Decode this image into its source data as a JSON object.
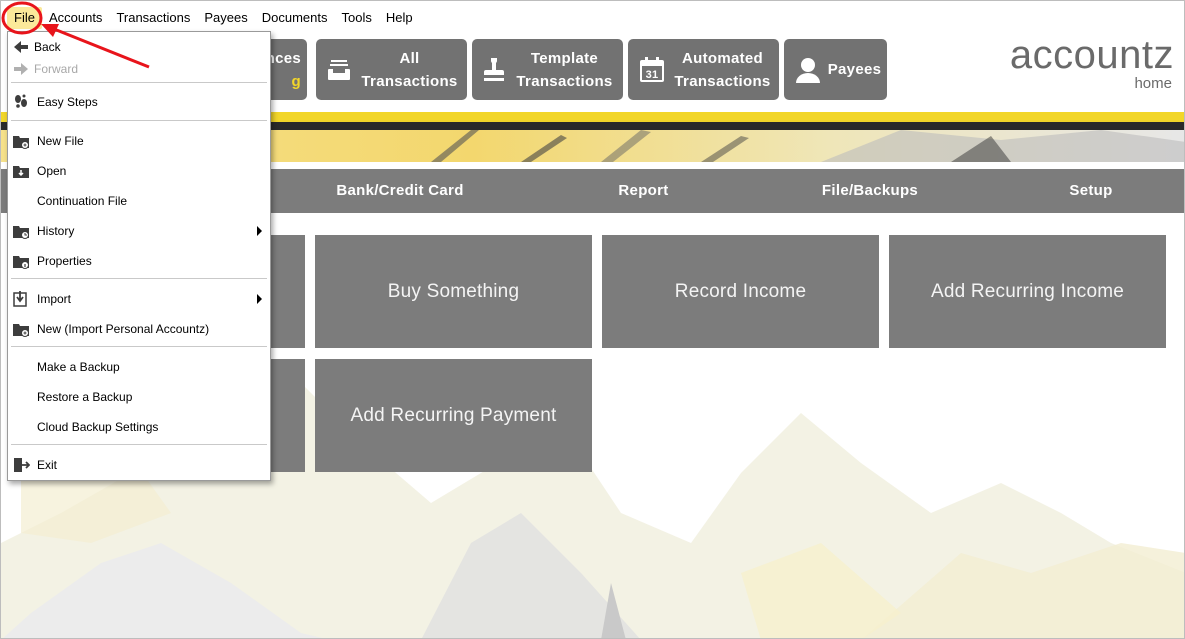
{
  "menubar": [
    "File",
    "Accounts",
    "Transactions",
    "Payees",
    "Documents",
    "Tools",
    "Help"
  ],
  "nav_buttons": {
    "partial_line1": "nces",
    "partial_line2": "g",
    "all": [
      "All",
      "Transactions"
    ],
    "template": [
      "Template",
      "Transactions"
    ],
    "automated": [
      "Automated",
      "Transactions"
    ],
    "payees": "Payees",
    "calendar_day": "31"
  },
  "logo": {
    "word": "accountz",
    "sub": "home"
  },
  "tabs": [
    "Bank/Credit Card",
    "Report",
    "File/Backups",
    "Setup"
  ],
  "tiles": [
    "Buy Something",
    "Record Income",
    "Add Recurring Income",
    "Add Recurring Payment"
  ],
  "file_menu": {
    "back": "Back",
    "forward": "Forward",
    "easy_steps": "Easy Steps",
    "new_file": "New File",
    "open": "Open",
    "continuation_file": "Continuation File",
    "history": "History",
    "properties": "Properties",
    "import": "Import",
    "new_import": "New (Import Personal Accountz)",
    "make_backup": "Make a Backup",
    "restore_backup": "Restore a Backup",
    "cloud_backup": "Cloud Backup Settings",
    "exit": "Exit"
  },
  "colors": {
    "accent_yellow": "#f2d629",
    "tile_grey": "#7c7c7c",
    "nav_grey": "#727272",
    "annotation_red": "#e8141b"
  }
}
